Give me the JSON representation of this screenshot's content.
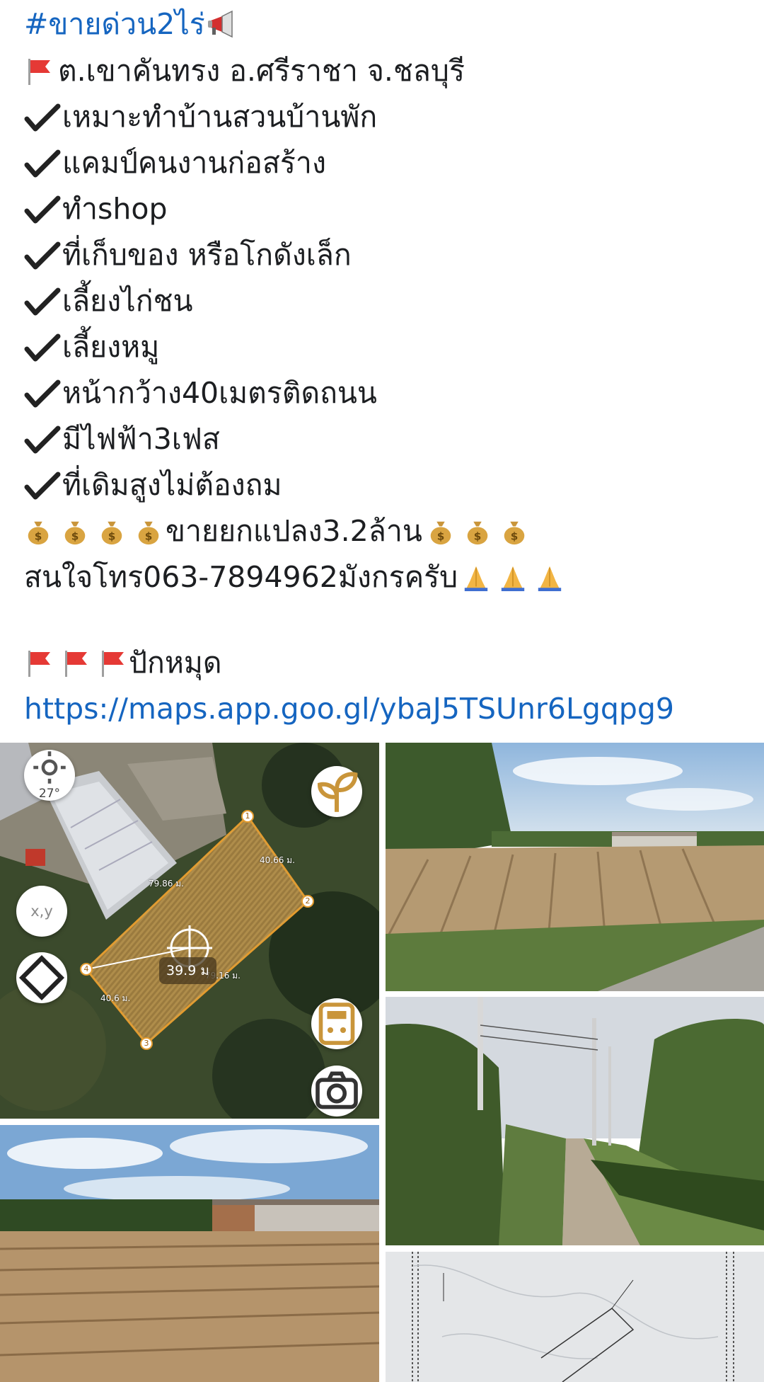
{
  "post": {
    "hashtag": "#ขายด่วน2ไร่",
    "location": "ต.เขาคันทรง อ.ศรีราชา จ.ชลบุรี",
    "features": [
      "เหมาะทำบ้านสวนบ้านพัก",
      "แคมป์คนงานก่อสร้าง",
      "ทำshop",
      "ที่เก็บของ หรือโกดังเล็ก",
      "เลี้ยงไก่ชน",
      "เลี้ยงหมู",
      "หน้ากว้าง40เมตรติดถนน",
      "มีไฟฟ้า3เฟส",
      "ที่เดิมสูงไม่ต้องถม"
    ],
    "price": "ขายยกแปลง3.2ล้าน",
    "contact": "สนใจโทร063-7894962มังกรครับ",
    "pin": "ปักหมุด",
    "map_link": "https://maps.app.goo.gl/ybaJ5TSUnr6Lgqpg9"
  },
  "map_overlay": {
    "temperature": "27°",
    "xy_button": "x,y",
    "area": "39.9 ม",
    "side_a": "40.66 ม.",
    "side_b": "79.86 ม.",
    "side_c": "79.16 ม.",
    "side_d": "40.6 ม.",
    "corners": [
      "1",
      "2",
      "3",
      "4"
    ]
  },
  "icons": {
    "megaphone": "megaphone-icon",
    "flag": "red-flag-icon",
    "check": "check-mark-icon",
    "money": "money-bag-icon",
    "pray": "folded-hands-icon"
  },
  "colors": {
    "link": "#1565c0",
    "text": "#1c1e21",
    "plot_outline": "#e39b2e"
  }
}
